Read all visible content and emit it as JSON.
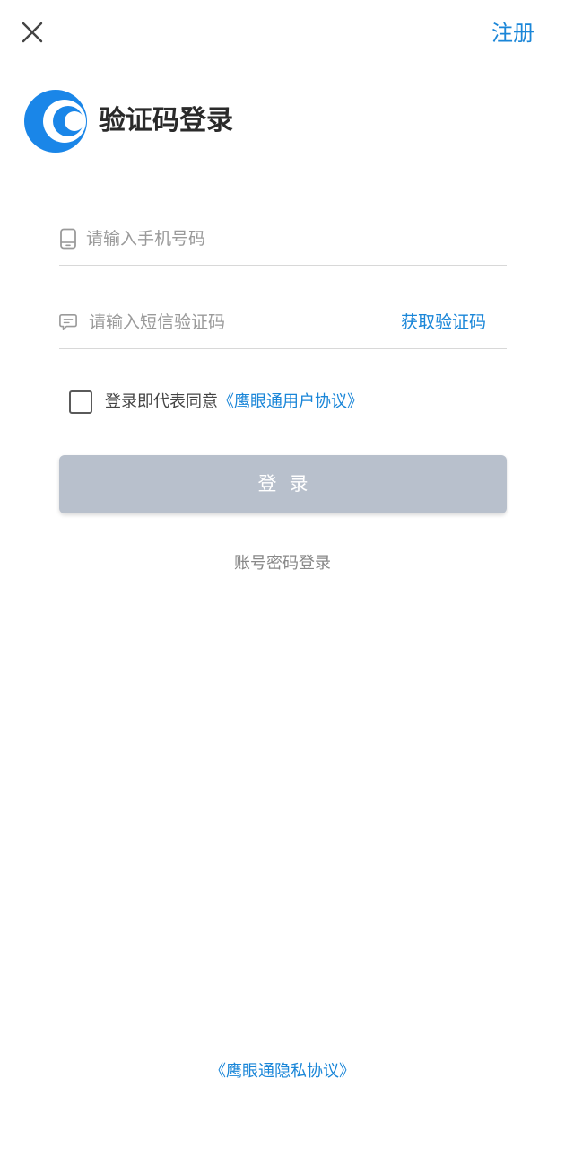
{
  "header": {
    "close_icon": "close-icon",
    "register_label": "注册"
  },
  "brand": {
    "logo_icon": "eagle-eye-logo",
    "logo_color": "#1a86e8"
  },
  "title": "验证码登录",
  "phone_field": {
    "icon": "phone-icon",
    "placeholder": "请输入手机号码",
    "value": ""
  },
  "code_field": {
    "icon": "message-icon",
    "placeholder": "请输入短信验证码",
    "value": "",
    "get_code_label": "获取验证码"
  },
  "agreement": {
    "checked": false,
    "text": "登录即代表同意",
    "link_label": "《鹰眼通用户协议》"
  },
  "login_button": {
    "label": "登录",
    "color": "#b8c0cc"
  },
  "password_login_label": "账号密码登录",
  "privacy_link_label": "《鹰眼通隐私协议》",
  "colors": {
    "accent": "#1a86d8"
  }
}
